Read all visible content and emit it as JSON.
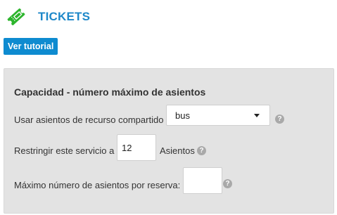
{
  "header": {
    "title": "TICKETS",
    "icon": "ticket-icon",
    "icon_color": "#2db52d",
    "title_color": "#1e88c9"
  },
  "tutorial_button": {
    "label": "Ver tutorial"
  },
  "panel": {
    "title": "Capacidad - número máximo de asientos",
    "shared_resource": {
      "label": "Usar asientos de recurso compartido",
      "selected": "bus"
    },
    "restrict": {
      "label_before": "Restringir este servicio a",
      "value": "12",
      "label_after": "Asientos"
    },
    "max_per_booking": {
      "label": "Máximo número de asientos por reserva:",
      "value": ""
    },
    "help_icon": "?"
  }
}
